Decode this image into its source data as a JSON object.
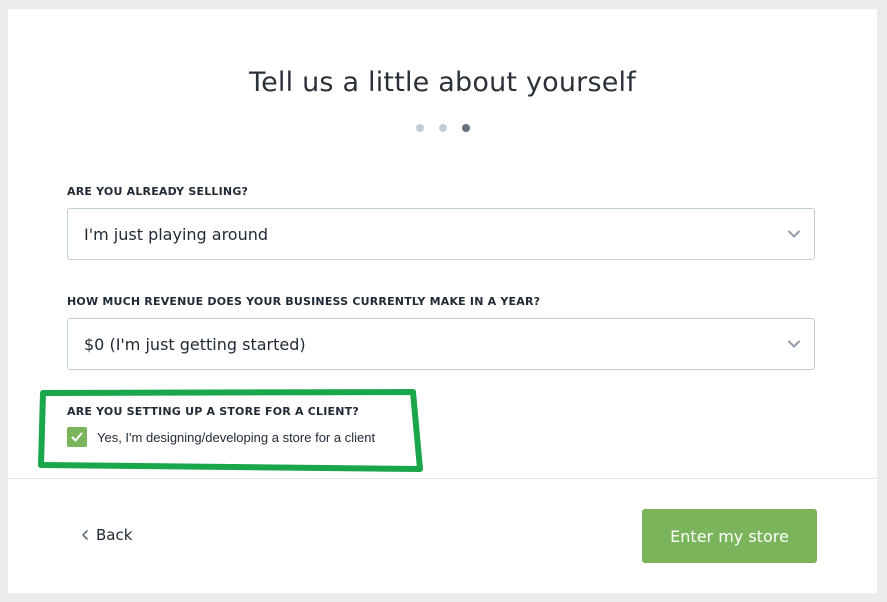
{
  "header": {
    "title": "Tell us a little about yourself"
  },
  "progress": {
    "total_steps": 3,
    "current_step": 3
  },
  "fields": {
    "selling": {
      "label": "ARE YOU ALREADY SELLING?",
      "value": "I'm just playing around"
    },
    "revenue": {
      "label": "HOW MUCH REVENUE DOES YOUR BUSINESS CURRENTLY MAKE IN A YEAR?",
      "value": "$0 (I'm just getting started)"
    },
    "client": {
      "label": "ARE YOU SETTING UP A STORE FOR A CLIENT?",
      "checkbox_label": "Yes, I'm designing/developing a store for a client",
      "checked": true
    }
  },
  "footer": {
    "back_label": "Back",
    "submit_label": "Enter my store"
  },
  "colors": {
    "accent": "#7ab55c",
    "annotation": "#1aa64a",
    "dot_inactive": "#c4cdd5",
    "dot_active": "#637381"
  },
  "icons": [
    "chevron-down-icon",
    "checkmark-icon",
    "chevron-left-icon"
  ]
}
